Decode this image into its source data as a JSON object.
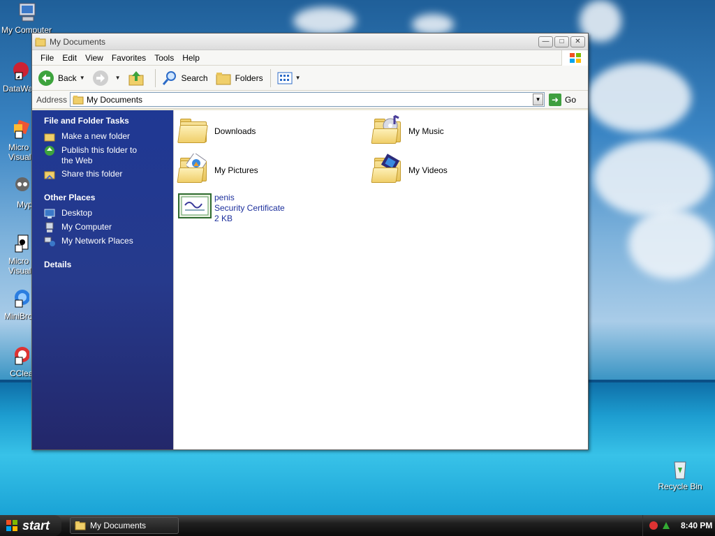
{
  "desktop": {
    "icons": [
      {
        "label": "My Computer"
      },
      {
        "label": "DataWa"
      },
      {
        "label": "Micro\nVisual"
      },
      {
        "label": "Myp"
      },
      {
        "label": "Micro\nVisual"
      },
      {
        "label": "MiniBro"
      },
      {
        "label": "CClea"
      }
    ],
    "recycle_bin": "Recycle Bin"
  },
  "window": {
    "title": "My Documents",
    "menu": [
      "File",
      "Edit",
      "View",
      "Favorites",
      "Tools",
      "Help"
    ],
    "toolbar": {
      "back": "Back",
      "search": "Search",
      "folders": "Folders"
    },
    "address": {
      "label": "Address",
      "value": "My Documents",
      "go": "Go"
    },
    "task_pane": {
      "file_tasks": {
        "heading": "File and Folder Tasks",
        "items": [
          "Make a new folder",
          "Publish this folder to the Web",
          "Share this folder"
        ]
      },
      "other_places": {
        "heading": "Other Places",
        "items": [
          "Desktop",
          "My Computer",
          "My Network Places"
        ]
      },
      "details": {
        "heading": "Details"
      }
    },
    "files": [
      {
        "name": "Downloads",
        "type": "folder"
      },
      {
        "name": "My Music",
        "type": "music-folder"
      },
      {
        "name": "My Pictures",
        "type": "pictures-folder"
      },
      {
        "name": "My Videos",
        "type": "videos-folder"
      },
      {
        "name": "penis",
        "subtype": "Security Certificate",
        "size": "2 KB",
        "type": "certificate"
      }
    ]
  },
  "taskbar": {
    "start": "start",
    "task": "My Documents",
    "clock": "8:40 PM"
  }
}
